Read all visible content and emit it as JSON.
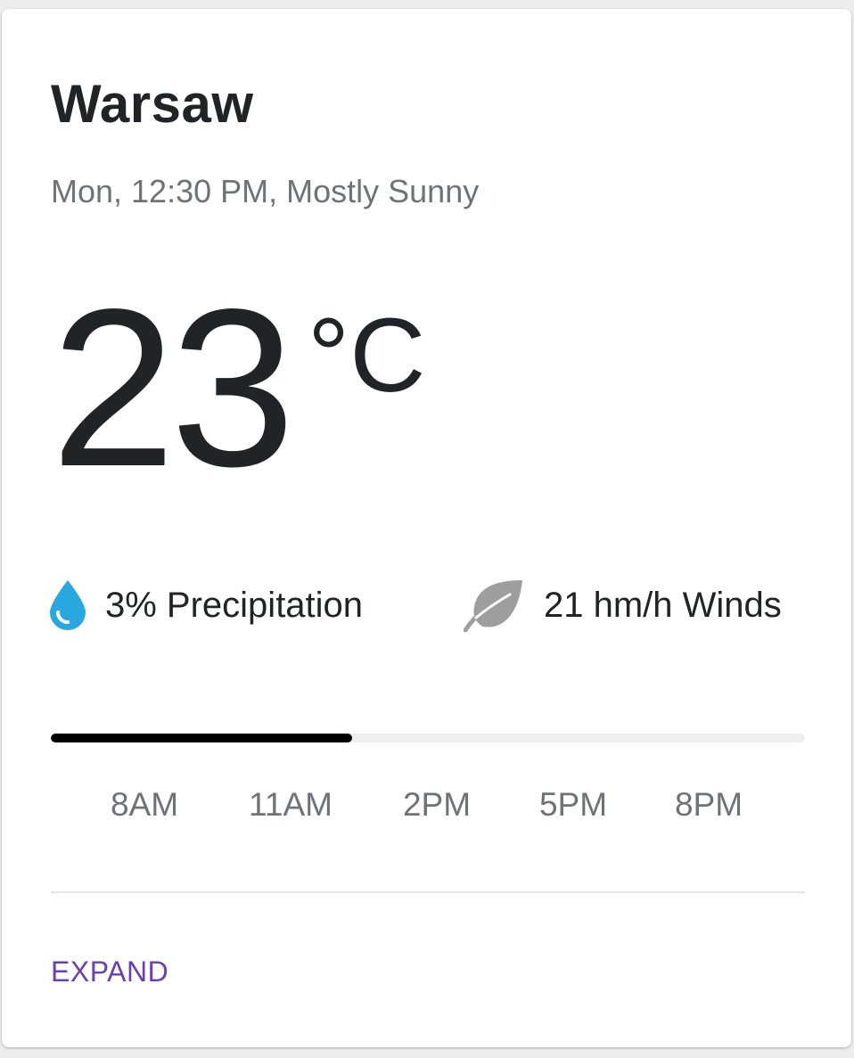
{
  "card": {
    "city": "Warsaw",
    "subtitle": "Mon, 12:30 PM, Mostly Sunny",
    "temperature": {
      "value": "23",
      "unit": "°C"
    },
    "precipitation": {
      "label": "3% Precipitation",
      "icon": "water-drop-icon",
      "icon_color": "#29a8e0"
    },
    "wind": {
      "label": "21 hm/h Winds",
      "icon": "leaf-icon",
      "icon_color": "#9e9e9e"
    },
    "timeline": {
      "progress": 0.4,
      "times": [
        "8AM",
        "11AM",
        "2PM",
        "5PM",
        "8PM"
      ]
    },
    "action": {
      "expand_label": "EXPAND",
      "color": "#6a3fb0"
    }
  }
}
